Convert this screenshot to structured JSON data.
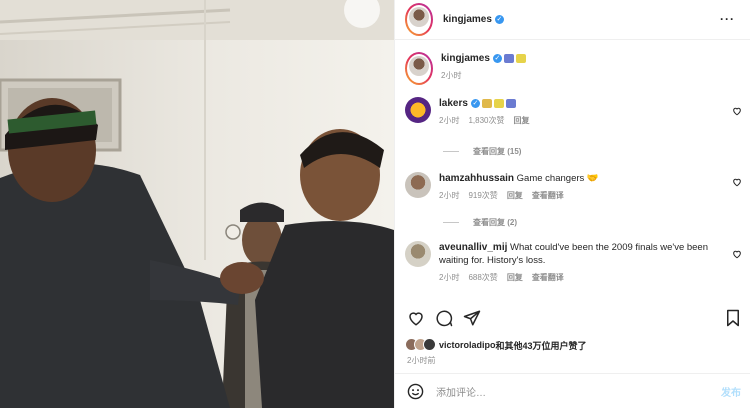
{
  "header": {
    "username": "kingjames"
  },
  "caption": {
    "username": "kingjames",
    "time": "2小时"
  },
  "comments": [
    {
      "username": "lakers",
      "text": "",
      "time": "2小时",
      "likes": "1,830次赞",
      "reply": "回复",
      "view_replies": "查看回复 (15)"
    },
    {
      "username": "hamzahhussain",
      "text": "Game changers",
      "time": "2小时",
      "likes": "919次赞",
      "reply": "回复",
      "translate": "查看翻译",
      "view_replies": "查看回复 (2)"
    },
    {
      "username": "aveunalliv_mij",
      "text": "What could've been the 2009 finals we've been waiting for. History's loss.",
      "time": "2小时",
      "likes": "688次赞",
      "reply": "回复",
      "translate": "查看翻译"
    }
  ],
  "likes": {
    "username": "victoroladipo",
    "text": "和其他43万位用户赞了"
  },
  "post_time": "2小时前",
  "comment_input": {
    "placeholder": "添加评论…",
    "post_label": "发布"
  },
  "icons": [
    "more-icon",
    "verified-icon",
    "heart-icon",
    "comment-icon",
    "share-icon",
    "bookmark-icon",
    "emoji-icon"
  ],
  "colors": {
    "verified": "#3897f0",
    "meta": "#8e8e8e",
    "post_button": "#b2dffc",
    "lakers_purple": "#552583",
    "lakers_gold": "#fdb927"
  }
}
